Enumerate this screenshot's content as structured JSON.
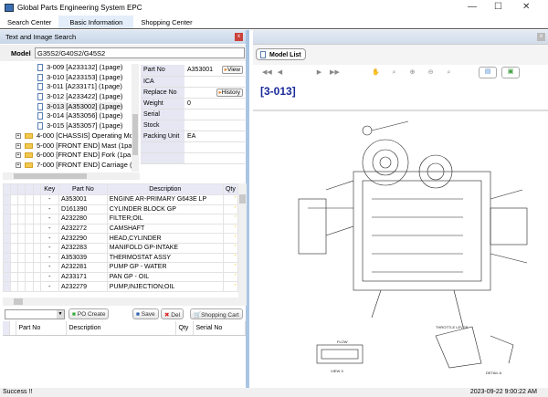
{
  "app": {
    "title": "Global Parts Engineering System EPC"
  },
  "menu": [
    {
      "label": "Search Center"
    },
    {
      "label": "Basic Information"
    },
    {
      "label": "Shopping Center"
    }
  ],
  "left_panel": {
    "title": "Text and Image Search",
    "close": "x",
    "model_label": "Model",
    "model_value": "G35S2/G40S2/G45S2"
  },
  "tree": [
    {
      "label": "3-009 [A233132]  (1page)",
      "type": "doc"
    },
    {
      "label": "3-010 [A233153]  (1page)",
      "type": "doc"
    },
    {
      "label": "3-011 [A233171]  (1page)",
      "type": "doc"
    },
    {
      "label": "3-012 [A233422]  (1page)",
      "type": "doc"
    },
    {
      "label": "3-013 [A353002]  (1page)",
      "type": "doc",
      "selected": true
    },
    {
      "label": "3-014 [A353056]  (1page)",
      "type": "doc"
    },
    {
      "label": "3-015 [A353057]  (1page)",
      "type": "doc"
    },
    {
      "label": "4-000 [CHASSIS] Operating Mc",
      "type": "folder"
    },
    {
      "label": "5-000 [FRONT END] Mast (1pa",
      "type": "folder"
    },
    {
      "label": "6-000 [FRONT END] Fork (1pa",
      "type": "folder"
    },
    {
      "label": "7-000 [FRONT END] Carriage (",
      "type": "folder"
    }
  ],
  "info": [
    {
      "key": "Part No",
      "value": "A353001",
      "button": "View"
    },
    {
      "key": "ICA",
      "value": ""
    },
    {
      "key": "Replace No",
      "value": "",
      "button": "History"
    },
    {
      "key": "Weight",
      "value": "0"
    },
    {
      "key": "Serial",
      "value": ""
    },
    {
      "key": "Stock",
      "value": ""
    },
    {
      "key": "Packing Unit",
      "value": "EA"
    },
    {
      "key": "",
      "value": ""
    },
    {
      "key": "",
      "value": ""
    }
  ],
  "parts_grid": {
    "columns": [
      "Key",
      "Part No",
      "Description",
      "Qty"
    ],
    "rows": [
      [
        "-",
        "A353001",
        "ENGINE AR-PRIMARY G643E LP"
      ],
      [
        "-",
        "D161390",
        "CYLINDER BLOCK GP"
      ],
      [
        "-",
        "A232280",
        "FILTER;OIL"
      ],
      [
        "-",
        "A232272",
        "CAMSHAFT"
      ],
      [
        "-",
        "A232290",
        "HEAD,CYLINDER"
      ],
      [
        "-",
        "A232283",
        "MANIFOLD GP-INTAKE"
      ],
      [
        "-",
        "A353039",
        "THERMOSTAT ASSY"
      ],
      [
        "-",
        "A232281",
        "PUMP GP - WATER"
      ],
      [
        "-",
        "A233171",
        "PAN GP - OIL"
      ],
      [
        "-",
        "A232279",
        "PUMP,INJECTION;OIL"
      ]
    ]
  },
  "toolbar": {
    "po_create": "PO Create",
    "save": "Save",
    "del": "Del",
    "shopping_cart": "Shopping Cart"
  },
  "cart_grid": {
    "columns": [
      "Part No",
      "Description",
      "Qty",
      "Serial No"
    ]
  },
  "right_panel": {
    "model_list": "Model List",
    "page_id": "[3-013]",
    "close": "x"
  },
  "drawing_labels": {
    "throttle": "THROTTLE LEVER",
    "view": "VIEW X",
    "detail": "DETAIL A",
    "flow": "FLOW"
  },
  "status": {
    "message": "Success !!",
    "datetime": "2023-09-22 9:00:22 AM"
  }
}
